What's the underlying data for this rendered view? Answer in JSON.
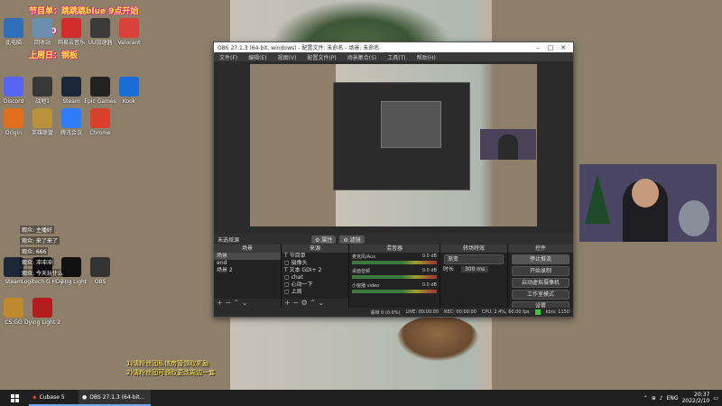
{
  "overlay": {
    "top_banner": "节目单：跳跳跳blue 9点开始",
    "counter_label": "+300",
    "channel_note": "上周日：钢板",
    "bottom_notes": [
      "1)请粉丝团私信房管领取奖励",
      "2)请粉丝团可领取更改周边一套"
    ]
  },
  "desktop_icons": [
    {
      "name": "此电脑",
      "color": "#2e6fb8"
    },
    {
      "name": "回收站",
      "color": "#6c8fb0"
    },
    {
      "name": "网易云音乐",
      "color": "#d02c2c"
    },
    {
      "name": "UU加速器",
      "color": "#3b3b3b"
    },
    {
      "name": "Valorant",
      "color": "#d9413b"
    },
    {
      "name": "Discord",
      "color": "#5865f2"
    },
    {
      "name": "战地1",
      "color": "#383838"
    },
    {
      "name": "Steam",
      "color": "#1b2838"
    },
    {
      "name": "Epic Games",
      "color": "#222"
    },
    {
      "name": "Kook",
      "color": "#1a6fd6"
    },
    {
      "name": "Origin",
      "color": "#e1701e"
    },
    {
      "name": "英雄联盟",
      "color": "#b8913a"
    },
    {
      "name": "腾讯会议",
      "color": "#2d7ef6"
    },
    {
      "name": "Chrome",
      "color": "#d8402b"
    },
    {
      "name": "Steam",
      "color": "#1b2838"
    },
    {
      "name": "Logitech G HUB",
      "color": "#111"
    },
    {
      "name": "Dying Light",
      "color": "#111"
    },
    {
      "name": "OBS",
      "color": "#333"
    },
    {
      "name": "CS:GO",
      "color": "#bf8a2d"
    },
    {
      "name": "Dying Light 2",
      "color": "#b31d1d"
    }
  ],
  "chat_lines": [
    "观众: 主播好",
    "观众: 来了来了",
    "观众: 666",
    "观众: 冲冲冲",
    "观众: 今天玩什么"
  ],
  "obs": {
    "title": "OBS 27.1.3 (64-bit, windows) - 配置文件: 未命名 - 场景: 未命名",
    "menu": [
      "文件(F)",
      "编辑(E)",
      "视图(V)",
      "配置文件(P)",
      "场景集合(S)",
      "工具(T)",
      "帮助(H)"
    ],
    "no_source_label": "未选择源",
    "props_btn": "属性",
    "filters_btn": "滤镜",
    "docks": {
      "scenes": {
        "title": "场景",
        "items": [
          "场景",
          "end",
          "场景 2"
        ]
      },
      "sources": {
        "title": "来源",
        "items": [
          "节目单",
          "摄像头",
          "文本 GDI+ 2",
          "chat",
          "心动一下",
          "上周"
        ]
      },
      "mixer": {
        "title": "混音器",
        "rows": [
          {
            "name": "麦克风/Aux",
            "db": "0.0 dB"
          },
          {
            "name": "桌面音频",
            "db": "0.0 dB"
          },
          {
            "name": "小窗播 video",
            "db": "0.0 dB"
          }
        ]
      },
      "transitions": {
        "title": "转场特效",
        "type": "渐变",
        "duration_label": "时长",
        "duration": "300 ms"
      },
      "controls": {
        "title": "控件",
        "buttons": [
          "停止推流",
          "开始录制",
          "启动虚拟摄像机",
          "工作室模式",
          "设置",
          "退出"
        ]
      }
    },
    "status": {
      "dropped": "丢帧 0 (0.0%)",
      "live": "LIVE: 00:00:00",
      "rec": "REC: 00:00:00",
      "cpu": "CPU: 2.4%, 60.00 fps",
      "kbps": "kb/s: 1150"
    }
  },
  "taskbar": {
    "items": [
      "Cubase 5",
      "OBS 27.1.3 (64-bit..."
    ],
    "lang": "ENG",
    "time": "20:37",
    "date": "2022/2/10"
  }
}
